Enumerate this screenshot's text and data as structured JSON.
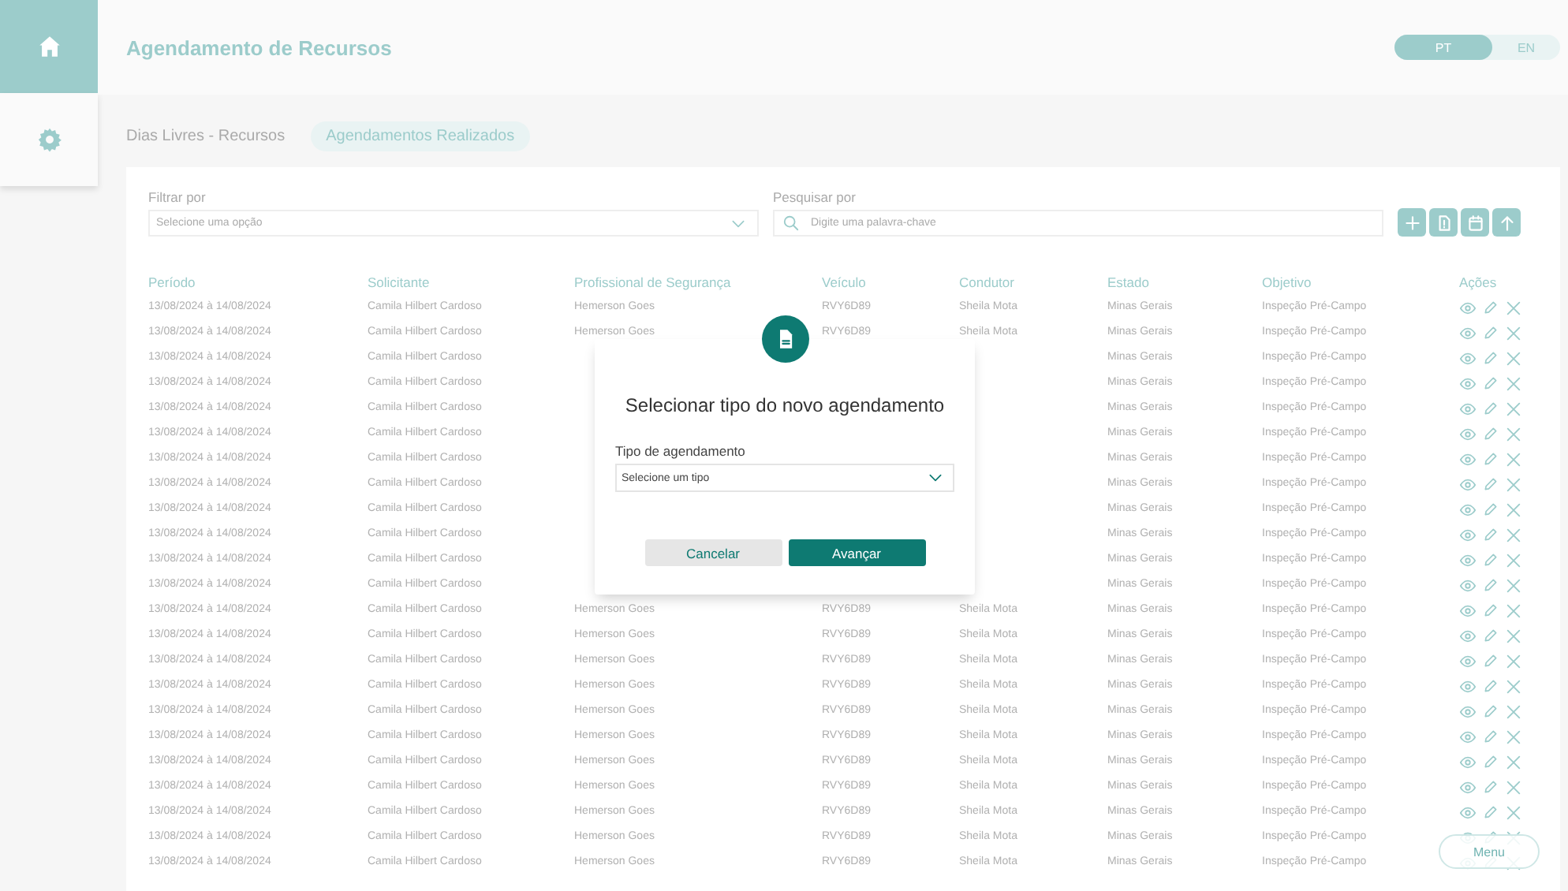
{
  "sidebar": {
    "items": [
      {
        "kind": "home",
        "selected": true
      },
      {
        "kind": "settings",
        "selected": false
      }
    ]
  },
  "header": {
    "title": "Agendamento de Recursos",
    "languages": [
      {
        "label": "PT",
        "selected": true
      },
      {
        "label": "EN",
        "selected": false
      }
    ]
  },
  "tabs": [
    {
      "label": "Dias Livres - Recursos",
      "selected": false
    },
    {
      "label": "Agendamentos Realizados",
      "selected": true
    }
  ],
  "filter": {
    "label": "Filtrar por",
    "placeholder": "Selecione uma opção"
  },
  "search": {
    "label": "Pesquisar por",
    "placeholder": "Digite uma palavra-chave"
  },
  "toolbar": [
    {
      "kind": "add"
    },
    {
      "kind": "report"
    },
    {
      "kind": "calendar"
    },
    {
      "kind": "upload"
    }
  ],
  "table": {
    "columns": [
      "Período",
      "Solicitante",
      "Profissional de Segurança",
      "Veículo",
      "Condutor",
      "Estado",
      "Objetivo",
      "Ações"
    ],
    "rows": [
      {
        "cells": [
          "13/08/2024 à 14/08/2024",
          "Camila Hilbert Cardoso",
          "Hemerson Goes",
          "RVY6D89",
          "Sheila Mota",
          "Minas Gerais",
          "Inspeção Pré-Campo"
        ]
      },
      {
        "cells": [
          "13/08/2024 à 14/08/2024",
          "Camila Hilbert Cardoso",
          "Hemerson Goes",
          "RVY6D89",
          "Sheila Mota",
          "Minas Gerais",
          "Inspeção Pré-Campo"
        ]
      },
      {
        "cells": [
          "13/08/2024 à 14/08/2024",
          "Camila Hilbert Cardoso",
          null,
          null,
          null,
          "Minas Gerais",
          "Inspeção Pré-Campo"
        ]
      },
      {
        "cells": [
          "13/08/2024 à 14/08/2024",
          "Camila Hilbert Cardoso",
          null,
          null,
          null,
          "Minas Gerais",
          "Inspeção Pré-Campo"
        ]
      },
      {
        "cells": [
          "13/08/2024 à 14/08/2024",
          "Camila Hilbert Cardoso",
          null,
          null,
          null,
          "Minas Gerais",
          "Inspeção Pré-Campo"
        ]
      },
      {
        "cells": [
          "13/08/2024 à 14/08/2024",
          "Camila Hilbert Cardoso",
          null,
          null,
          null,
          "Minas Gerais",
          "Inspeção Pré-Campo"
        ]
      },
      {
        "cells": [
          "13/08/2024 à 14/08/2024",
          "Camila Hilbert Cardoso",
          null,
          null,
          null,
          "Minas Gerais",
          "Inspeção Pré-Campo"
        ]
      },
      {
        "cells": [
          "13/08/2024 à 14/08/2024",
          "Camila Hilbert Cardoso",
          null,
          null,
          null,
          "Minas Gerais",
          "Inspeção Pré-Campo"
        ]
      },
      {
        "cells": [
          "13/08/2024 à 14/08/2024",
          "Camila Hilbert Cardoso",
          null,
          null,
          null,
          "Minas Gerais",
          "Inspeção Pré-Campo"
        ]
      },
      {
        "cells": [
          "13/08/2024 à 14/08/2024",
          "Camila Hilbert Cardoso",
          null,
          null,
          null,
          "Minas Gerais",
          "Inspeção Pré-Campo"
        ]
      },
      {
        "cells": [
          "13/08/2024 à 14/08/2024",
          "Camila Hilbert Cardoso",
          null,
          null,
          null,
          "Minas Gerais",
          "Inspeção Pré-Campo"
        ]
      },
      {
        "cells": [
          "13/08/2024 à 14/08/2024",
          "Camila Hilbert Cardoso",
          null,
          null,
          null,
          "Minas Gerais",
          "Inspeção Pré-Campo"
        ]
      },
      {
        "cells": [
          "13/08/2024 à 14/08/2024",
          "Camila Hilbert Cardoso",
          "Hemerson Goes",
          "RVY6D89",
          "Sheila Mota",
          "Minas Gerais",
          "Inspeção Pré-Campo"
        ]
      },
      {
        "cells": [
          "13/08/2024 à 14/08/2024",
          "Camila Hilbert Cardoso",
          "Hemerson Goes",
          "RVY6D89",
          "Sheila Mota",
          "Minas Gerais",
          "Inspeção Pré-Campo"
        ]
      },
      {
        "cells": [
          "13/08/2024 à 14/08/2024",
          "Camila Hilbert Cardoso",
          "Hemerson Goes",
          "RVY6D89",
          "Sheila Mota",
          "Minas Gerais",
          "Inspeção Pré-Campo"
        ]
      },
      {
        "cells": [
          "13/08/2024 à 14/08/2024",
          "Camila Hilbert Cardoso",
          "Hemerson Goes",
          "RVY6D89",
          "Sheila Mota",
          "Minas Gerais",
          "Inspeção Pré-Campo"
        ]
      },
      {
        "cells": [
          "13/08/2024 à 14/08/2024",
          "Camila Hilbert Cardoso",
          "Hemerson Goes",
          "RVY6D89",
          "Sheila Mota",
          "Minas Gerais",
          "Inspeção Pré-Campo"
        ]
      },
      {
        "cells": [
          "13/08/2024 à 14/08/2024",
          "Camila Hilbert Cardoso",
          "Hemerson Goes",
          "RVY6D89",
          "Sheila Mota",
          "Minas Gerais",
          "Inspeção Pré-Campo"
        ]
      },
      {
        "cells": [
          "13/08/2024 à 14/08/2024",
          "Camila Hilbert Cardoso",
          "Hemerson Goes",
          "RVY6D89",
          "Sheila Mota",
          "Minas Gerais",
          "Inspeção Pré-Campo"
        ]
      },
      {
        "cells": [
          "13/08/2024 à 14/08/2024",
          "Camila Hilbert Cardoso",
          "Hemerson Goes",
          "RVY6D89",
          "Sheila Mota",
          "Minas Gerais",
          "Inspeção Pré-Campo"
        ]
      },
      {
        "cells": [
          "13/08/2024 à 14/08/2024",
          "Camila Hilbert Cardoso",
          "Hemerson Goes",
          "RVY6D89",
          "Sheila Mota",
          "Minas Gerais",
          "Inspeção Pré-Campo"
        ]
      },
      {
        "cells": [
          "13/08/2024 à 14/08/2024",
          "Camila Hilbert Cardoso",
          "Hemerson Goes",
          "RVY6D89",
          "Sheila Mota",
          "Minas Gerais",
          "Inspeção Pré-Campo"
        ]
      },
      {
        "cells": [
          "13/08/2024 à 14/08/2024",
          "Camila Hilbert Cardoso",
          "Hemerson Goes",
          "RVY6D89",
          "Sheila Mota",
          "Minas Gerais",
          "Inspeção Pré-Campo"
        ]
      }
    ]
  },
  "dialog": {
    "title": "Selecionar tipo do novo agendamento",
    "field_label": "Tipo de agendamento",
    "placeholder": "Selecione um tipo",
    "buttons": [
      {
        "label": "Cancelar",
        "kind": "secondary"
      },
      {
        "label": "Avançar",
        "kind": "primary"
      }
    ]
  },
  "menu_button": {
    "label": "Menu"
  }
}
